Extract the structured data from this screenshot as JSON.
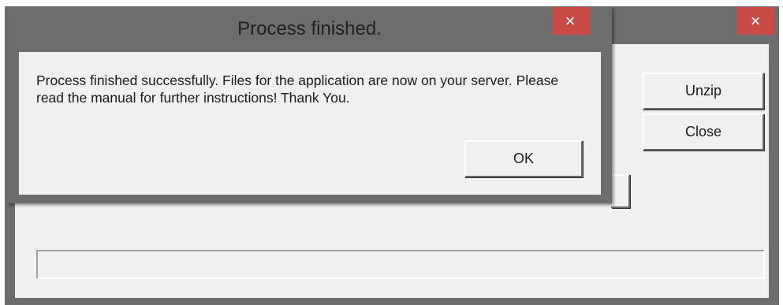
{
  "main_window": {
    "close_glyph": "×",
    "buttons": {
      "unzip_label": "Unzip",
      "close_label": "Close"
    }
  },
  "dialog": {
    "title": "Process finished.",
    "close_glyph": "×",
    "message": "Process finished successfully. Files for the application are now on your server. Please read the manual for further instructions! Thank You.",
    "ok_label": "OK"
  },
  "colors": {
    "titlebar": "#6d6d6d",
    "close_button": "#c74a47",
    "client_area": "#f0f0f0"
  },
  "icons": {
    "close": "close-icon"
  }
}
